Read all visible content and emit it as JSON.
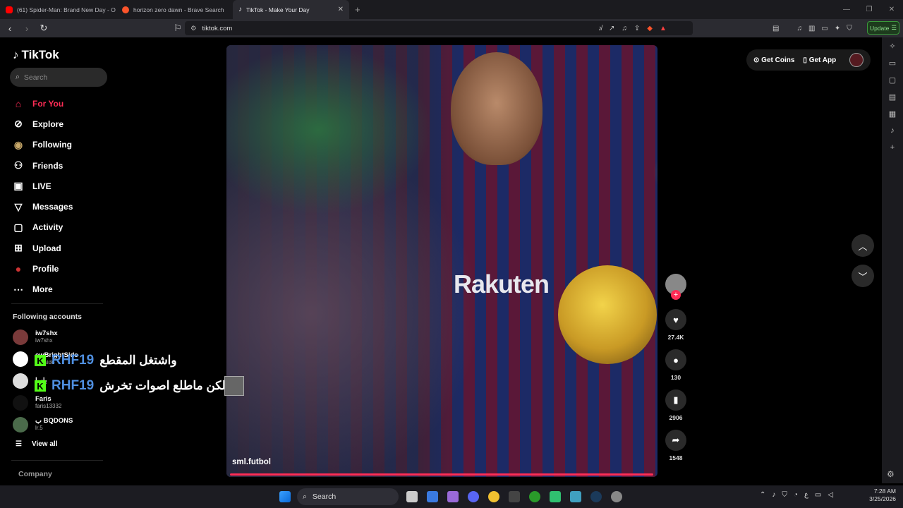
{
  "browser": {
    "tabs": [
      {
        "title": "(61) Spider-Man: Brand New Day - O",
        "color": "#ff0000",
        "active": false
      },
      {
        "title": "horizon zero dawn - Brave Search",
        "color": "#fb542b",
        "active": false
      },
      {
        "title": "TikTok - Make Your Day",
        "color": "#ffffff",
        "active": true
      }
    ],
    "new_tab_icon": "plus-icon",
    "url": "tiktok.com",
    "update_label": "Update"
  },
  "tiktok": {
    "logo_text": "TikTok",
    "search_placeholder": "Search",
    "nav": [
      {
        "label": "For You",
        "icon": "home-icon",
        "glyph": "⌂",
        "active": true
      },
      {
        "label": "Explore",
        "icon": "compass-icon",
        "glyph": "⊘"
      },
      {
        "label": "Following",
        "icon": "avatar-icon",
        "glyph": "◉"
      },
      {
        "label": "Friends",
        "icon": "friends-icon",
        "glyph": "⚇"
      },
      {
        "label": "LIVE",
        "icon": "live-icon",
        "glyph": "▣"
      },
      {
        "label": "Messages",
        "icon": "messages-icon",
        "glyph": "▽"
      },
      {
        "label": "Activity",
        "icon": "activity-icon",
        "glyph": "▢"
      },
      {
        "label": "Upload",
        "icon": "upload-icon",
        "glyph": "⊞"
      },
      {
        "label": "Profile",
        "icon": "profile-icon",
        "glyph": "●"
      },
      {
        "label": "More",
        "icon": "more-icon",
        "glyph": "⋯"
      }
    ],
    "following_title": "Following accounts",
    "following": [
      {
        "name": "iw7shx",
        "handle": "iw7shx"
      },
      {
        "name": "ewBrightSide",
        "handle": "ightside"
      },
      {
        "name": "باسا",
        "handle": ""
      },
      {
        "name": "Faris",
        "handle": "faris13332"
      },
      {
        "name": "ب BQDONS",
        "handle": "lr.5"
      }
    ],
    "view_all": "View all",
    "company": "Company",
    "video": {
      "author": "sml.futbol",
      "sponsor_text": "Rakuten",
      "likes": "27.4K",
      "comments": "130",
      "saves": "2906",
      "shares": "1548"
    },
    "top_right": {
      "get_coins": "Get Coins",
      "get_app": "Get App"
    }
  },
  "chat_overlay": [
    {
      "user": "RHF19",
      "message": "واشتغل المقطع"
    },
    {
      "user": "RHF19",
      "message": "لكن ماطلع اصوات تخرش"
    }
  ],
  "taskbar": {
    "search_label": "Search",
    "tray_lang": "ع",
    "time": "7:28 AM",
    "date": "3/25/2026"
  }
}
